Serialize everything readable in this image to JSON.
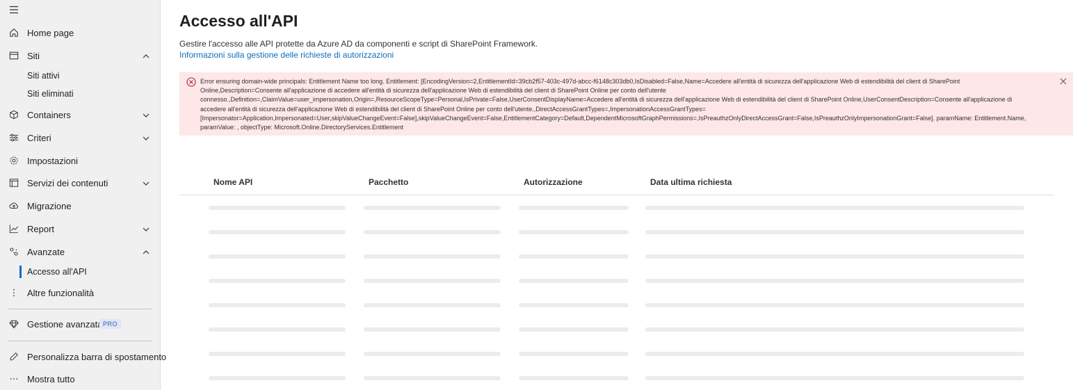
{
  "sidebar": {
    "items": [
      {
        "label": "Home page",
        "icon": "home-icon"
      },
      {
        "label": "Siti",
        "icon": "sites-icon",
        "expanded": true
      },
      {
        "label": "Containers",
        "icon": "containers-icon",
        "expanded": false
      },
      {
        "label": "Criteri",
        "icon": "policies-icon",
        "expanded": false
      },
      {
        "label": "Impostazioni",
        "icon": "settings-icon"
      },
      {
        "label": "Servizi dei contenuti",
        "icon": "content-services-icon",
        "expanded": false
      },
      {
        "label": "Migrazione",
        "icon": "migration-icon"
      },
      {
        "label": "Report",
        "icon": "report-icon",
        "expanded": false
      },
      {
        "label": "Avanzate",
        "icon": "advanced-icon",
        "expanded": true
      },
      {
        "label": "Altre funzionalità",
        "icon": "more-features-icon"
      },
      {
        "label": "Gestione avanzata",
        "icon": "diamond-icon",
        "badge": "PRO"
      },
      {
        "label": "Personalizza barra di spostamento",
        "icon": "pencil-icon"
      },
      {
        "label": "Mostra tutto",
        "icon": "ellipsis-icon"
      }
    ],
    "siti_sub": [
      "Siti attivi",
      "Siti eliminati"
    ],
    "avanzate_sub": [
      {
        "label": "Accesso all'API",
        "active": true
      }
    ]
  },
  "main": {
    "title": "Accesso all'API",
    "description": "Gestire l'accesso alle API protette da Azure AD da componenti e script di SharePoint Framework.",
    "link": "Informazioni sulla gestione delle richieste di autorizzazioni",
    "error": "Error ensuring domain-wide principals: Entitlement Name too long. Entitlement: [EncodingVersion=2,EntitlementId=39cb2f57-403c-497d-abcc-f6148c303db0,IsDisabled=False,Name=Accedere all'entità di sicurezza dell'applicazione Web di estendibilità del client di SharePoint Online,Description=Consente all'applicazione di accedere all'entità di sicurezza dell'applicazione Web di estendibilità del client di SharePoint Online per conto dell'utente connesso.,Definition=,ClaimValue=user_impersonation,Origin=,ResourceScopeType=Personal,IsPrivate=False,UserConsentDisplayName=Accedere all'entità di sicurezza dell'applicazione Web di estendibilità del client di SharePoint Online,UserConsentDescription=Consente all'applicazione di accedere all'entità di sicurezza dell'applicazione Web di estendibilità del client di SharePoint Online per conto dell'utente.,DirectAccessGrantTypes=,ImpersonationAccessGrantTypes=[Impersonator=Application,Impersonated=User,skipValueChangeEvent=False],skipValueChangeEvent=False,EntitlementCategory=Default,DependentMicrosoftGraphPermissions=,IsPreauthzOnlyDirectAccessGrant=False,IsPreauthzOnlyImpersonationGrant=False]. paramName: Entitlement.Name, paramValue: , objectType: Microsoft.Online.DirectoryServices.Entitlement",
    "columns": [
      "Nome API",
      "Pacchetto",
      "Autorizzazione",
      "Data ultima richiesta"
    ]
  },
  "colors": {
    "accent": "#0f6cbd",
    "error_background": "#fde7e9",
    "error_icon": "#a4262c",
    "sidebar_background": "#f0f0f0"
  }
}
